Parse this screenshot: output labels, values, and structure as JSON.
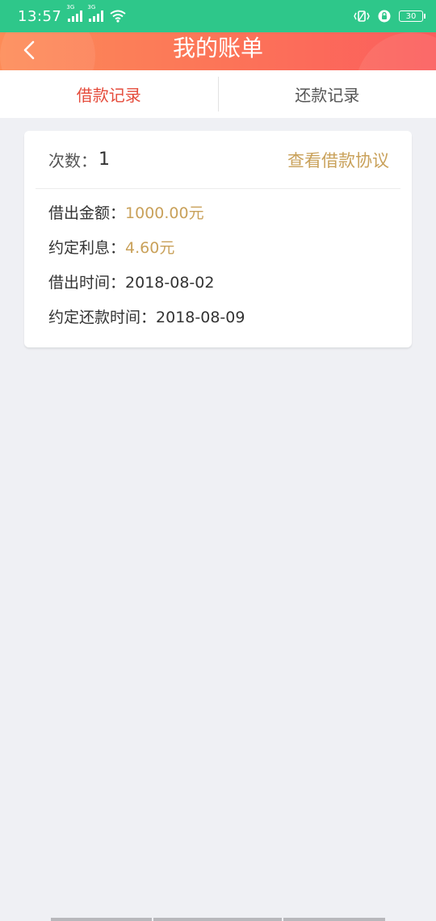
{
  "status": {
    "time": "13:57",
    "sim1": "3G",
    "sim2": "3G",
    "battery": "30"
  },
  "header": {
    "title": "我的账单"
  },
  "tabs": [
    {
      "label": "借款记录",
      "active": true
    },
    {
      "label": "还款记录",
      "active": false
    }
  ],
  "record": {
    "count_label": "次数：",
    "count_value": "1",
    "agreement_link": "查看借款协议",
    "amount_label": "借出金额：",
    "amount_value": "1000.00元",
    "interest_label": "约定利息：",
    "interest_value": "4.60元",
    "loan_date_label": "借出时间：",
    "loan_date_value": "2018-08-02",
    "repay_date_label": "约定还款时间：",
    "repay_date_value": "2018-08-09"
  },
  "colors": {
    "status_bar": "#2ec78a",
    "header_start": "#fd8b57",
    "header_end": "#fb5d5d",
    "active_tab": "#e54c3c",
    "gold": "#c9a15a",
    "background": "#eff0f4"
  }
}
